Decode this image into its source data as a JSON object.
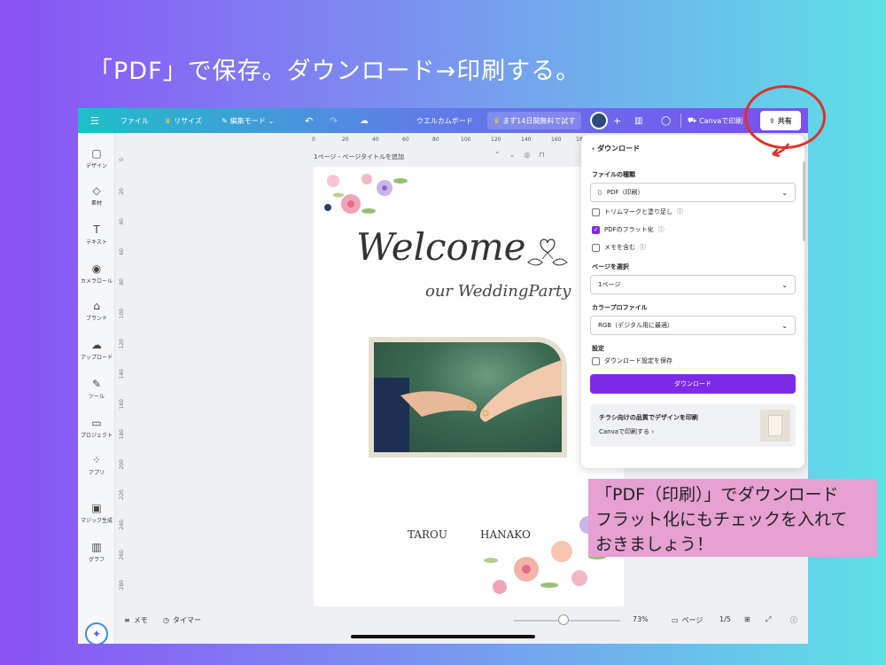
{
  "headline": "「PDF」で保存。ダウンロード→印刷する。",
  "toolbar": {
    "menu_icon": "menu-icon",
    "file": "ファイル",
    "resize": "リサイズ",
    "edit_mode": "編集モード",
    "doc_title": "ウエルカムボード",
    "trial": "まず14日間無料で試す",
    "print": "Canvaで印刷",
    "share": "共有"
  },
  "sidebar": {
    "items": [
      {
        "icon": "design-icon",
        "label": "デザイン"
      },
      {
        "icon": "elements-icon",
        "label": "素材"
      },
      {
        "icon": "text-icon",
        "label": "テキスト"
      },
      {
        "icon": "camera-icon",
        "label": "カメラロール"
      },
      {
        "icon": "brand-icon",
        "label": "ブランド"
      },
      {
        "icon": "upload-icon",
        "label": "アップロード"
      },
      {
        "icon": "tool-icon",
        "label": "ツール"
      },
      {
        "icon": "folder-icon",
        "label": "プロジェクト"
      },
      {
        "icon": "apps-icon",
        "label": "アプリ"
      },
      {
        "icon": "magic-icon",
        "label": "マジック生成"
      },
      {
        "icon": "chart-icon",
        "label": "グラフ"
      }
    ]
  },
  "rulers": {
    "top": [
      "0",
      "20",
      "40",
      "60",
      "80",
      "100",
      "120",
      "140",
      "160",
      "180",
      "200"
    ],
    "left": [
      "0",
      "20",
      "40",
      "60",
      "80",
      "100",
      "120",
      "140",
      "160",
      "180",
      "200",
      "220",
      "240",
      "260",
      "280"
    ]
  },
  "page_label": "1ページ - ページタイトルを追加",
  "canvas": {
    "welcome": "Welcome",
    "subtitle": "our WeddingParty",
    "name_left": "TAROU",
    "name_right": "HANAKO"
  },
  "download_panel": {
    "title": "ダウンロード",
    "file_type_label": "ファイルの種類",
    "file_type_value": "PDF（印刷）",
    "options": [
      {
        "label": "トリムマークと塗り足し",
        "checked": false
      },
      {
        "label": "PDFのフラット化",
        "checked": true
      },
      {
        "label": "メモを含む",
        "checked": false
      }
    ],
    "page_select_label": "ページを選択",
    "page_select_value": "1ページ",
    "color_profile_label": "カラープロファイル",
    "color_profile_value": "RGB（デジタル用に最適）",
    "settings_label": "設定",
    "save_settings": "ダウンロード設定を保存",
    "download_button": "ダウンロード",
    "promo_title": "チラシ向けの品質でデザインを印刷",
    "promo_link": "Canvaで印刷する"
  },
  "bottom": {
    "notes": "メモ",
    "timer": "タイマー",
    "zoom": "73%",
    "pages": "ページ",
    "page_count": "1/5",
    "zoom_fraction": 0.42
  },
  "callout": {
    "line1": "「PDF（印刷）」でダウンロード",
    "line2": "フラット化にもチェックを入れて",
    "line3": "おきましょう！"
  },
  "colors": {
    "accent": "#7d2ae8",
    "annotation_circle": "#e0302a",
    "callout_bg": "#e6a0d2"
  }
}
